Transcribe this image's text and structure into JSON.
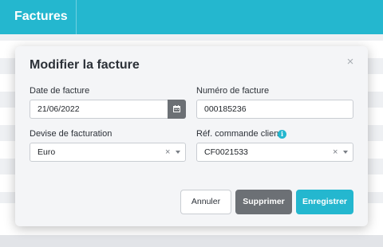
{
  "app": {
    "title": "Factures"
  },
  "modal": {
    "title": "Modifier la facture",
    "close_icon": "×",
    "date_label": "Date de facture",
    "date_value": "21/06/2022",
    "number_label": "Numéro de facture",
    "number_value": "000185236",
    "currency_label": "Devise de facturation",
    "currency_value": "Euro",
    "ref_label": "Réf. commande client",
    "ref_value": "CF0021533",
    "info_glyph": "i",
    "clear_glyph": "×",
    "buttons": {
      "cancel": "Annuler",
      "delete": "Supprimer",
      "save": "Enregistrer"
    }
  },
  "colors": {
    "brand": "#24b7cf",
    "secondary": "#6c7075",
    "modal_bg": "#f4f5f7"
  },
  "icons": [
    "calendar-icon",
    "close-icon",
    "info-icon",
    "clear-icon",
    "chevron-down-icon"
  ]
}
